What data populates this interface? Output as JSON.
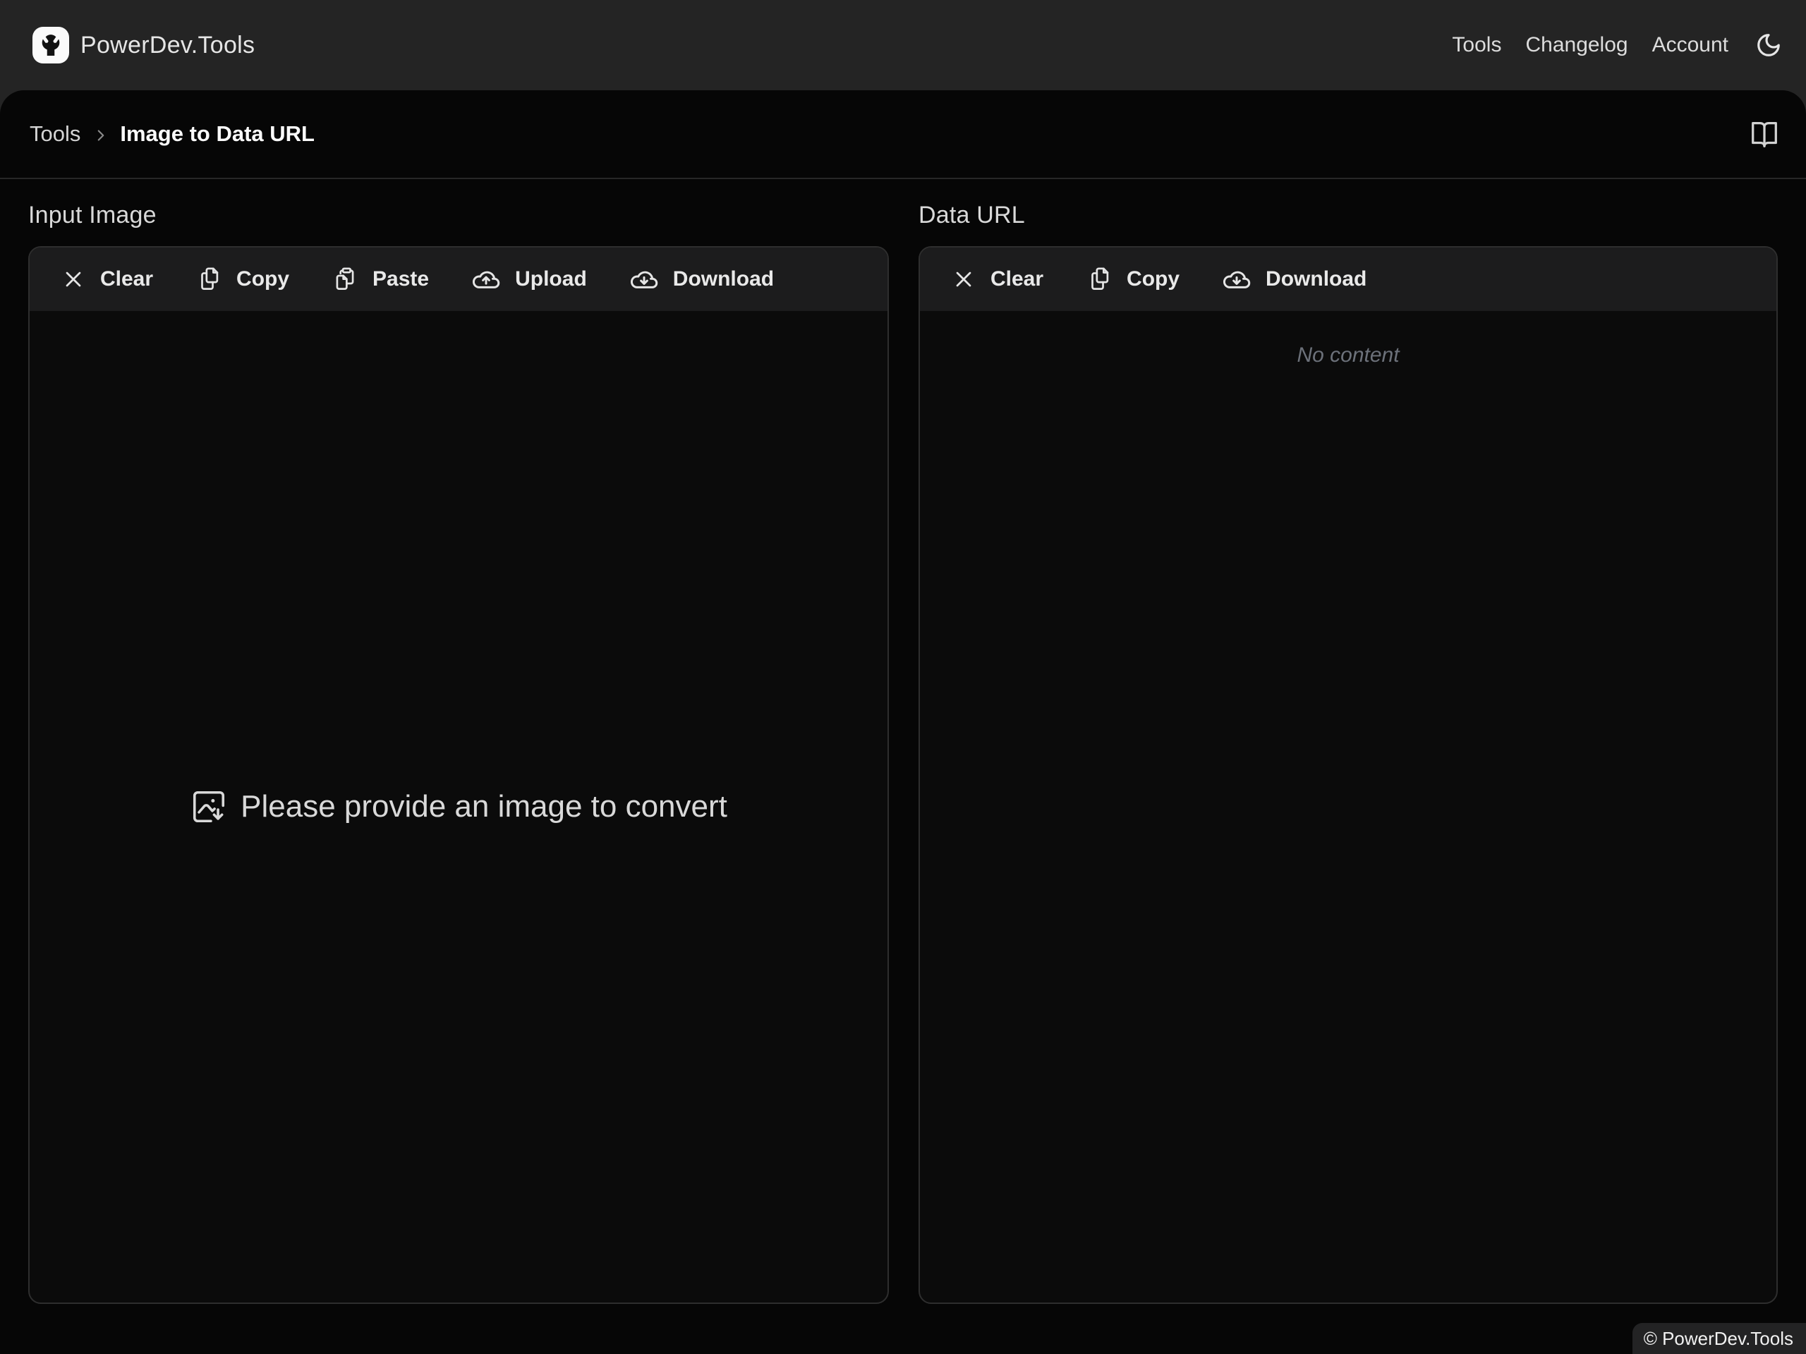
{
  "header": {
    "brand": "PowerDev.Tools",
    "logo_icon": "wrench-icon",
    "nav": {
      "tools": "Tools",
      "changelog": "Changelog",
      "account": "Account"
    },
    "theme_icon": "moon-icon"
  },
  "breadcrumb": {
    "parent": "Tools",
    "separator_icon": "chevron-right-icon",
    "current": "Image to Data URL",
    "docs_icon": "book-open-icon"
  },
  "panels": {
    "input": {
      "title": "Input Image",
      "toolbar": [
        {
          "label": "Clear",
          "icon": "x-icon"
        },
        {
          "label": "Copy",
          "icon": "copy-pages-icon"
        },
        {
          "label": "Paste",
          "icon": "clipboard-paste-icon"
        },
        {
          "label": "Upload",
          "icon": "cloud-upload-icon"
        },
        {
          "label": "Download",
          "icon": "cloud-download-icon"
        }
      ],
      "empty_message": "Please provide an image to convert",
      "empty_icon": "image-down-icon"
    },
    "output": {
      "title": "Data URL",
      "toolbar": [
        {
          "label": "Clear",
          "icon": "x-icon"
        },
        {
          "label": "Copy",
          "icon": "copy-pages-icon"
        },
        {
          "label": "Download",
          "icon": "cloud-download-icon"
        }
      ],
      "empty_message": "No content"
    }
  },
  "footer": {
    "copyright": "© PowerDev.Tools"
  },
  "colors": {
    "header_bg": "#242424",
    "sheet_bg": "#060606",
    "panel_bg": "#0b0b0b",
    "toolbar_bg": "#1c1c1d",
    "border": "#2e2e2e",
    "text_primary": "#e3e3e3",
    "text_bright": "#fafafa",
    "text_muted": "#6c717a",
    "logo_bg": "#fafafa"
  }
}
